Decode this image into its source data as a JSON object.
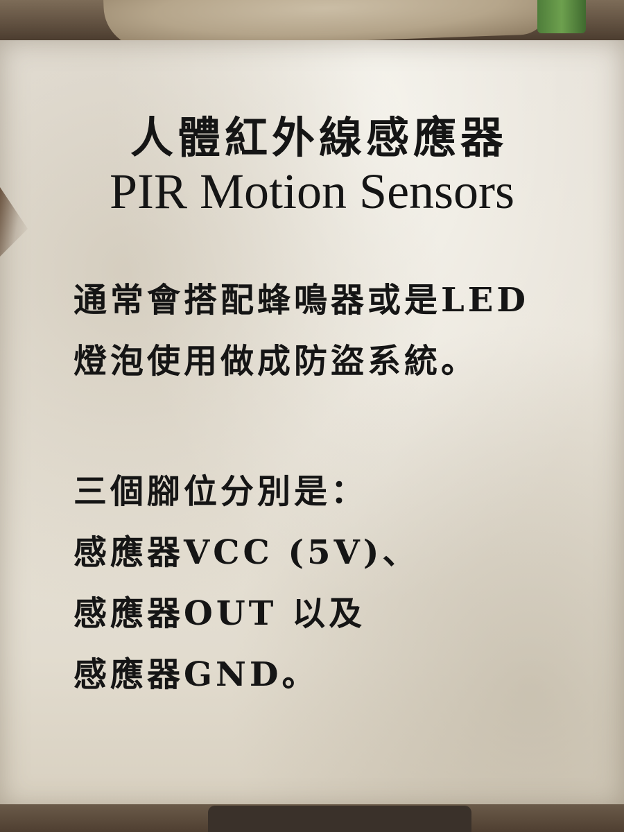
{
  "title": {
    "chinese": "人體紅外線感應器",
    "english": "PIR Motion Sensors"
  },
  "paragraph1": {
    "line1": "通常會搭配蜂鳴器或是LED",
    "line2": "燈泡使用做成防盜系統。"
  },
  "paragraph2": {
    "line1": "三個腳位分別是：",
    "line2": "感應器VCC (5V)、",
    "line3": "感應器OUT 以及",
    "line4": "感應器GND。"
  },
  "colors": {
    "paper": "#e6e1d8",
    "frame": "#4f3f31",
    "text": "#151515",
    "accent_green": "#6da04e"
  }
}
